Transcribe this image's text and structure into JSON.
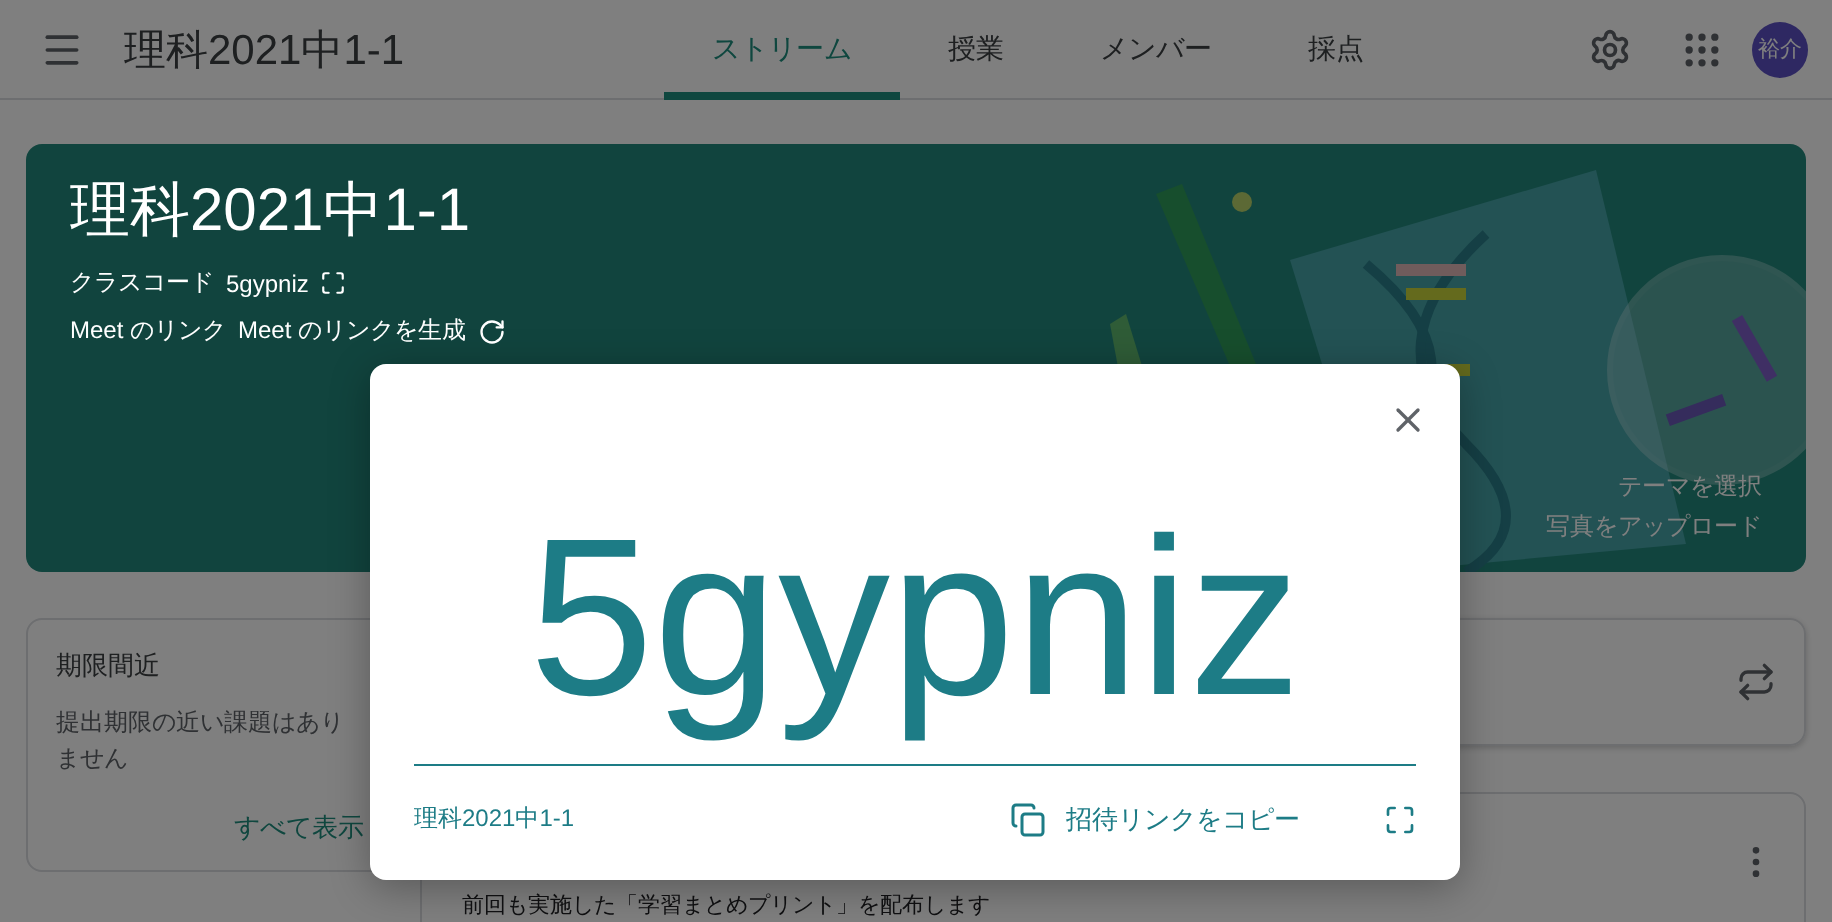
{
  "header": {
    "title": "理科2021中1-1",
    "avatar": "裕介",
    "tabs": [
      {
        "label": "ストリーム",
        "selected": true
      },
      {
        "label": "授業",
        "selected": false
      },
      {
        "label": "メンバー",
        "selected": false
      },
      {
        "label": "採点",
        "selected": false
      }
    ]
  },
  "banner": {
    "title": "理科2021中1-1",
    "class_code_label": "クラスコード",
    "class_code": "5gypniz",
    "meet_label": "Meet のリンク",
    "meet_action": "Meet のリンクを生成",
    "theme_link": "テーマを選択",
    "upload_link": "写真をアップロード"
  },
  "upcoming": {
    "title": "期限間近",
    "message": "提出期限の近い課題はありません",
    "view_all": "すべて表示"
  },
  "post": {
    "text": "前回も実施した「学習まとめプリント」を配布します"
  },
  "dialog": {
    "code": "5gypniz",
    "class_name": "理科2021中1-1",
    "copy_link": "招待リンクをコピー"
  }
}
